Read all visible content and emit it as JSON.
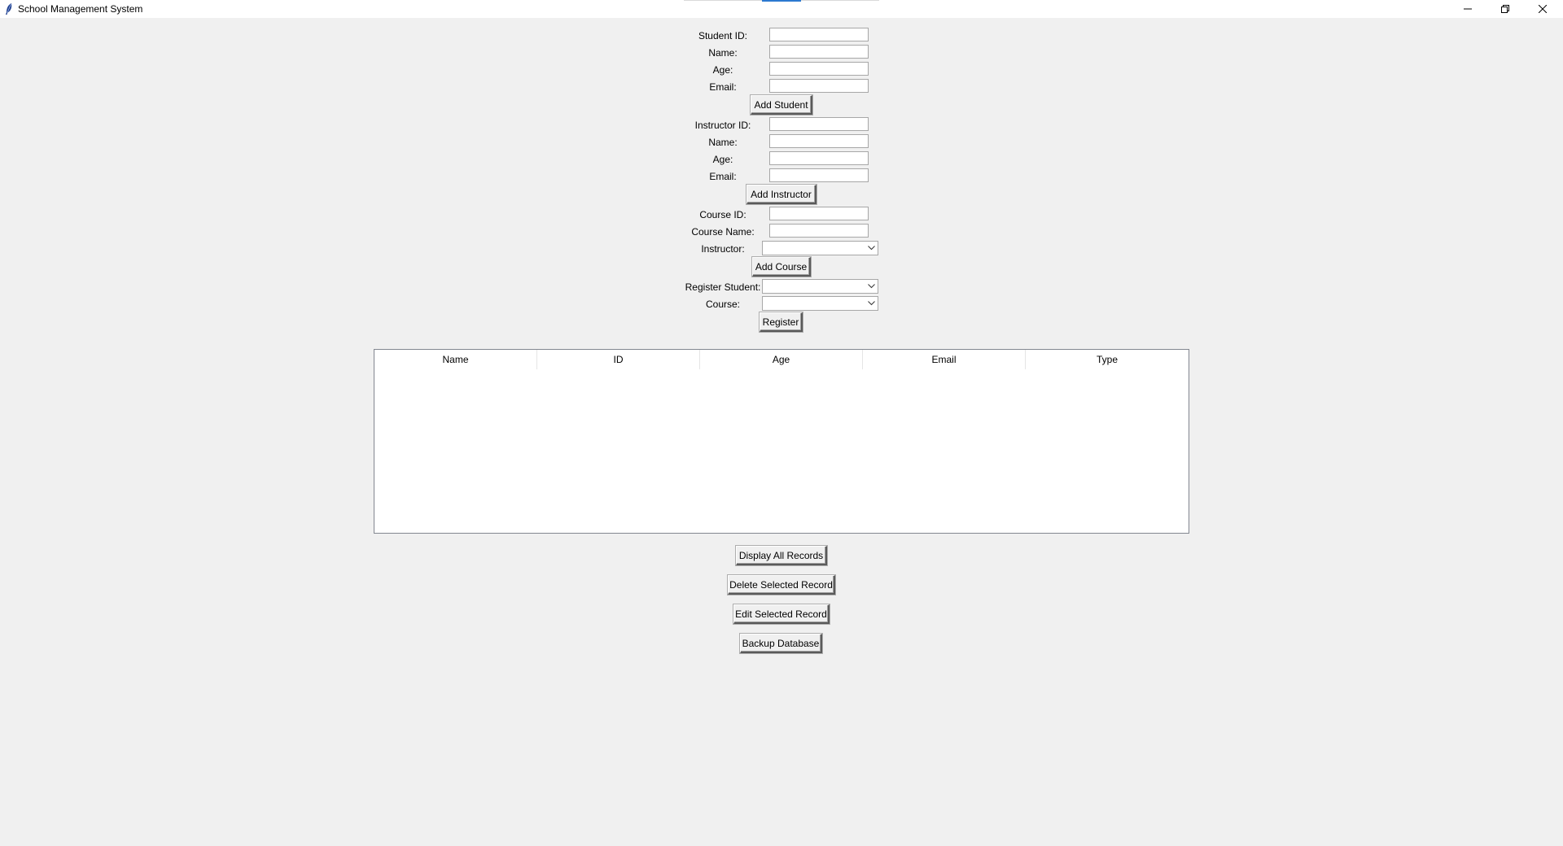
{
  "window": {
    "title": "School Management System",
    "accent_color": "#2b79d0"
  },
  "student_form": {
    "student_id_label": "Student ID:",
    "name_label": "Name:",
    "age_label": "Age:",
    "email_label": "Email:",
    "student_id_value": "",
    "name_value": "",
    "age_value": "",
    "email_value": "",
    "add_button": "Add Student"
  },
  "instructor_form": {
    "instructor_id_label": "Instructor ID:",
    "name_label": "Name:",
    "age_label": "Age:",
    "email_label": "Email:",
    "instructor_id_value": "",
    "name_value": "",
    "age_value": "",
    "email_value": "",
    "add_button": "Add Instructor"
  },
  "course_form": {
    "course_id_label": "Course ID:",
    "course_name_label": "Course Name:",
    "instructor_label": "Instructor:",
    "course_id_value": "",
    "course_name_value": "",
    "instructor_selected": "",
    "add_button": "Add Course"
  },
  "registration_form": {
    "student_label": "Register Student:",
    "course_label": "Course:",
    "student_selected": "",
    "course_selected": "",
    "register_button": "Register"
  },
  "records_table": {
    "columns": [
      "Name",
      "ID",
      "Age",
      "Email",
      "Type"
    ],
    "rows": []
  },
  "actions": {
    "display_all": "Display All Records",
    "delete_selected": "Delete Selected Record",
    "edit_selected": "Edit Selected Record",
    "backup": "Backup Database"
  },
  "icons": {
    "app": "feather-icon",
    "minimize": "minimize-icon",
    "maximize": "restore-icon",
    "close": "close-icon",
    "dropdown": "chevron-down-icon"
  }
}
